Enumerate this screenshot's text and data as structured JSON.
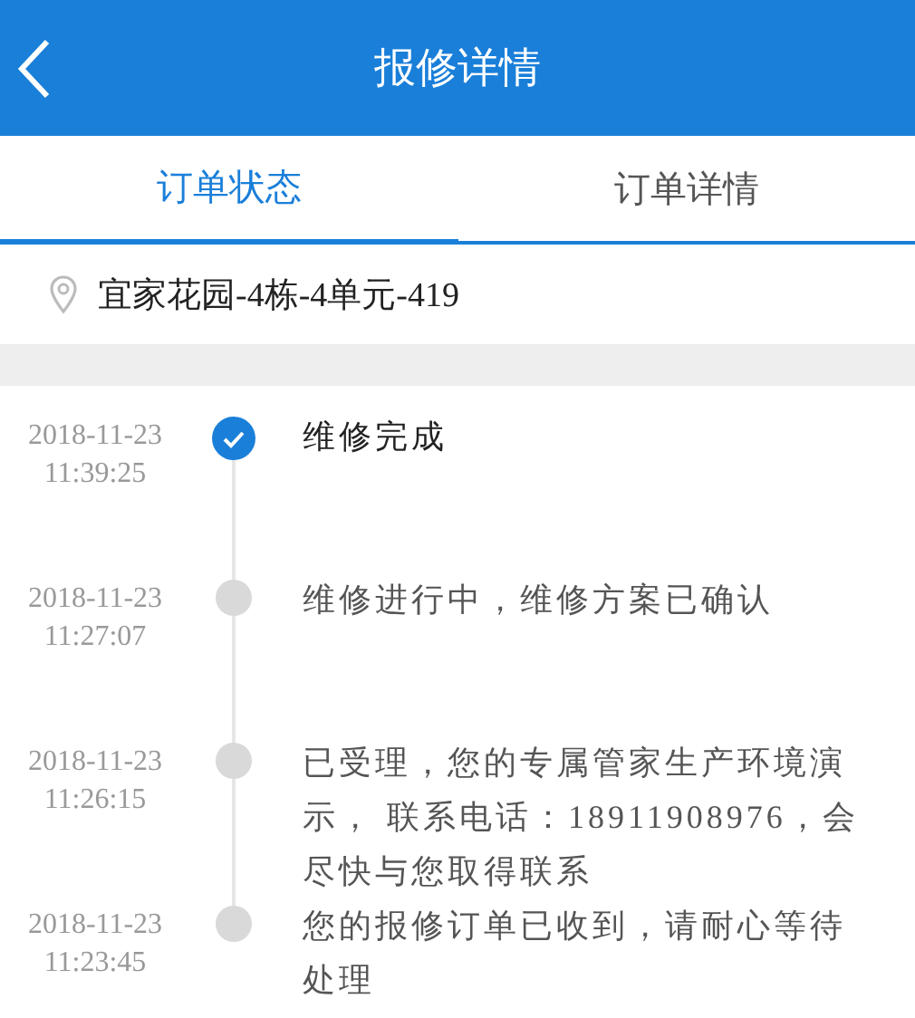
{
  "header": {
    "title": "报修详情"
  },
  "tabs": [
    {
      "label": "订单状态",
      "selected": true
    },
    {
      "label": "订单详情",
      "selected": false
    }
  ],
  "address": "宜家花园-4栋-4单元-419",
  "timeline": [
    {
      "date": "2018-11-23",
      "time": "11:39:25",
      "text": "维修完成",
      "completed": true
    },
    {
      "date": "2018-11-23",
      "time": "11:27:07",
      "text": "维修进行中，维修方案已确认",
      "completed": false
    },
    {
      "date": "2018-11-23",
      "time": "11:26:15",
      "text": "已受理，您的专属管家生产环境演示， 联系电话：18911908976，会尽快与您取得联系",
      "completed": false
    },
    {
      "date": "2018-11-23",
      "time": "11:23:45",
      "text": "您的报修订单已收到，请耐心等待处理",
      "completed": false
    }
  ]
}
